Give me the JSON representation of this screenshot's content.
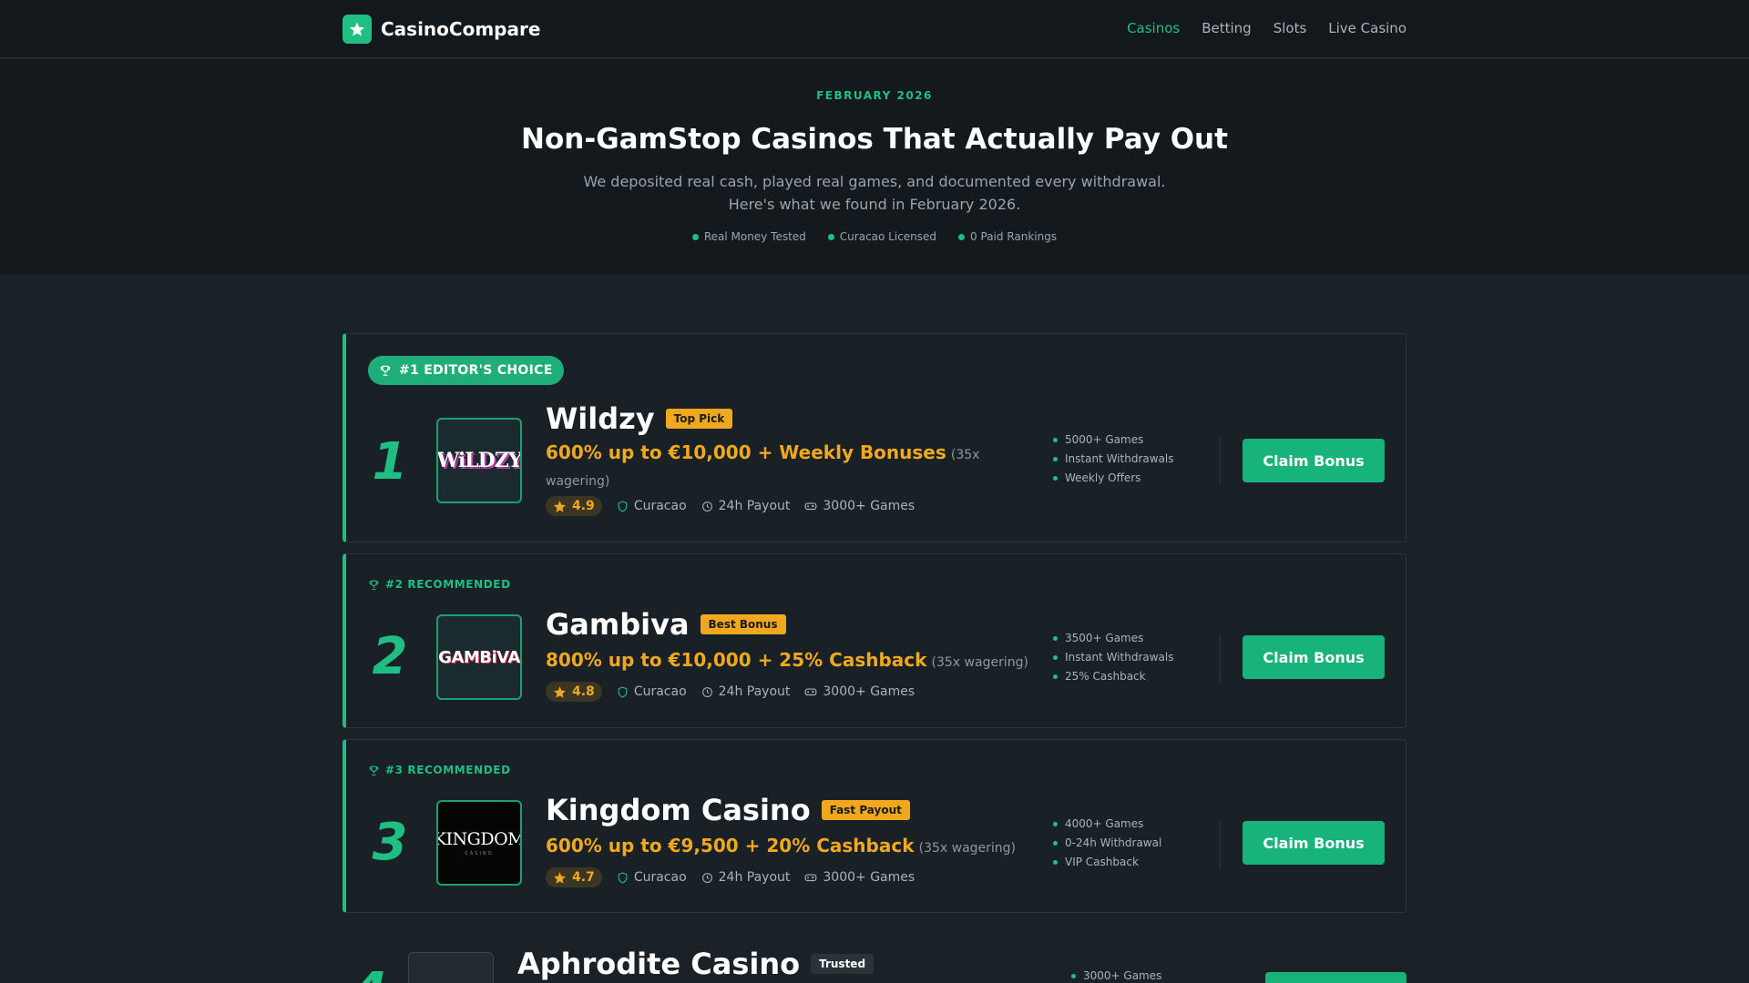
{
  "header": {
    "brand": "CasinoCompare",
    "nav": [
      "Casinos",
      "Betting",
      "Slots",
      "Live Casino"
    ]
  },
  "hero": {
    "date": "FEBRUARY 2026",
    "title": "Non-GamStop Casinos That Actually Pay Out",
    "subtitle_line1": "We deposited real cash, played real games, and documented every withdrawal.",
    "subtitle_line2": "Here's what we found in February 2026.",
    "tags": [
      "Real Money Tested",
      "Curacao Licensed",
      "0 Paid Rankings"
    ]
  },
  "casinos": [
    {
      "badge": "#1 EDITOR'S CHOICE",
      "rank": "1",
      "logo_text": "WiLDZY",
      "name": "Wildzy",
      "tag": "Top Pick",
      "offer": "600% up to €10,000 + Weekly Bonuses",
      "wagering": "(35x wagering)",
      "rating": "4.9",
      "license": "Curacao",
      "payout": "24h Payout",
      "games": "3000+ Games",
      "features": [
        "5000+ Games",
        "Instant Withdrawals",
        "Weekly Offers"
      ],
      "cta": "Claim Bonus"
    },
    {
      "badge": "#2 RECOMMENDED",
      "rank": "2",
      "logo_text": "GAMBiVA",
      "name": "Gambiva",
      "tag": "Best Bonus",
      "offer": "800% up to €10,000 + 25% Cashback",
      "wagering": "(35x wagering)",
      "rating": "4.8",
      "license": "Curacao",
      "payout": "24h Payout",
      "games": "3000+ Games",
      "features": [
        "3500+ Games",
        "Instant Withdrawals",
        "25% Cashback"
      ],
      "cta": "Claim Bonus"
    },
    {
      "badge": "#3 RECOMMENDED",
      "rank": "3",
      "logo_text": "KINGDOM",
      "logo_subtext": "CASINO",
      "name": "Kingdom Casino",
      "tag": "Fast Payout",
      "offer": "600% up to €9,500 + 20% Cashback",
      "wagering": "(35x wagering)",
      "rating": "4.7",
      "license": "Curacao",
      "payout": "24h Payout",
      "games": "3000+ Games",
      "features": [
        "4000+ Games",
        "0-24h Withdrawal",
        "VIP Cashback"
      ],
      "cta": "Claim Bonus"
    },
    {
      "rank": "4",
      "name": "Aphrodite Casino",
      "tag": "Trusted",
      "features": [
        "3000+ Games"
      ]
    }
  ],
  "colors": {
    "accent": "#1fbf84",
    "offer": "#f0a91f",
    "background": "#1b2227"
  }
}
